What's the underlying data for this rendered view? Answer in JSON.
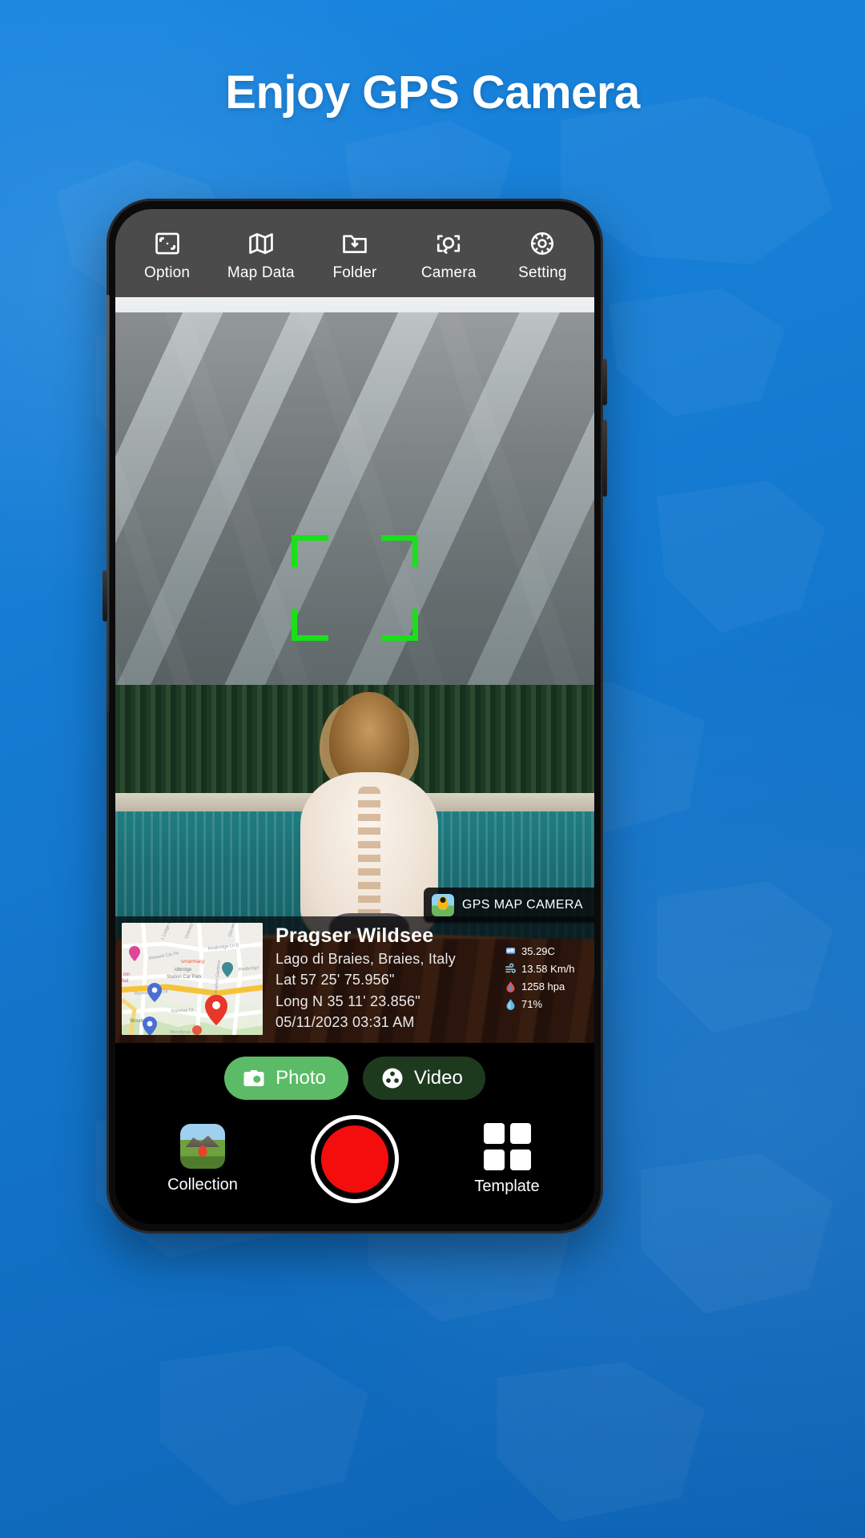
{
  "headline": "Enjoy GPS Camera",
  "theme": {
    "background_blue": "#1479cf",
    "accent_green": "#5cbb66",
    "idle_green": "#1d3a1f",
    "shutter_red": "#f40d0d",
    "focus_green": "#19e019",
    "toolbar_gray": "#4b4b4b"
  },
  "toolbar": {
    "items": [
      {
        "label": "Option",
        "icon": "crop-frame-icon"
      },
      {
        "label": "Map Data",
        "icon": "map-fold-icon"
      },
      {
        "label": "Folder",
        "icon": "folder-download-icon"
      },
      {
        "label": "Camera",
        "icon": "camera-switch-icon"
      },
      {
        "label": "Setting",
        "icon": "gear-icon"
      }
    ]
  },
  "viewfinder": {
    "focus_frame": "focus-brackets"
  },
  "watermark": {
    "text": "GPS MAP CAMERA",
    "icon": "gps-map-camera-logo"
  },
  "gps_card": {
    "title": "Pragser Wildsee",
    "subtitle": "Lago di Braies, Braies, Italy",
    "latitude": "Lat 57 25' 75.956\"",
    "longitude": "Long N 35 11' 23.856\"",
    "datetime": "05/11/2023  03:31 AM",
    "map_label_pharmacy": "smarmacy",
    "map_label_carpark": "idbridge Station Car Park",
    "map_label_redbridge": "Redbridge",
    "stats": [
      {
        "icon": "thermometer-icon",
        "value": "35.29C"
      },
      {
        "icon": "wind-icon",
        "value": "13.58 Km/h"
      },
      {
        "icon": "pressure-icon",
        "value": "1258 hpa"
      },
      {
        "icon": "humidity-icon",
        "value": "71%"
      }
    ]
  },
  "modes": [
    {
      "label": "Photo",
      "icon": "camera-icon",
      "state": "active"
    },
    {
      "label": "Video",
      "icon": "film-reel-icon",
      "state": "idle"
    }
  ],
  "bottom_bar": {
    "collection_label": "Collection",
    "collection_icon": "photo-thumbnail-icon",
    "shutter_label": "shutter-button",
    "template_label": "Template",
    "template_icon": "grid-icon"
  }
}
